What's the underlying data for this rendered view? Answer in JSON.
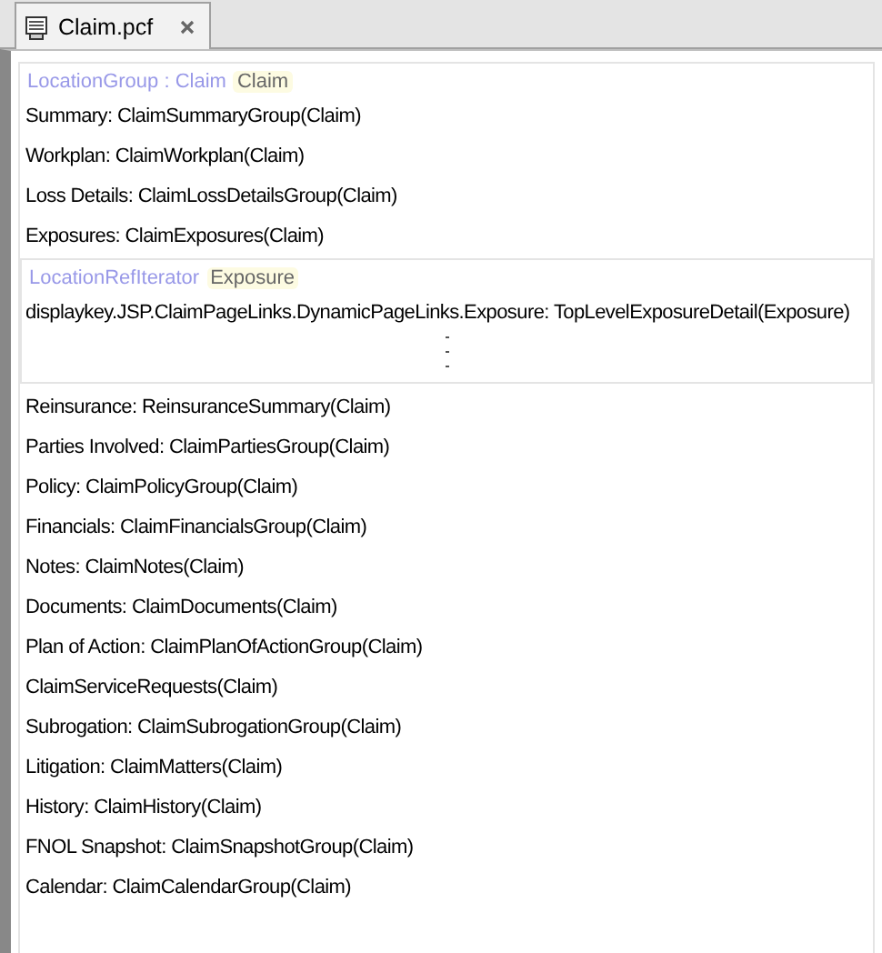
{
  "tabs": [
    {
      "label": "Claim.pcf",
      "selected": true
    }
  ],
  "group": {
    "label": "LocationGroup : Claim",
    "badge": "Claim",
    "entries": [
      {
        "kind": "link",
        "text": "Summary: ClaimSummaryGroup(Claim)"
      },
      {
        "kind": "link",
        "text": "Workplan: ClaimWorkplan(Claim)"
      },
      {
        "kind": "link",
        "text": "Loss Details: ClaimLossDetailsGroup(Claim)"
      },
      {
        "kind": "link",
        "text": "Exposures: ClaimExposures(Claim)"
      },
      {
        "kind": "iterator",
        "label": "LocationRefIterator",
        "badge": "Exposure",
        "children": [
          {
            "text": "displaykey.JSP.ClaimPageLinks.DynamicPageLinks.Exposure: TopLevelExposureDetail(Exposure)"
          }
        ]
      },
      {
        "kind": "link",
        "text": "Reinsurance: ReinsuranceSummary(Claim)"
      },
      {
        "kind": "link",
        "text": "Parties Involved: ClaimPartiesGroup(Claim)"
      },
      {
        "kind": "link",
        "text": "Policy: ClaimPolicyGroup(Claim)"
      },
      {
        "kind": "link",
        "text": "Financials: ClaimFinancialsGroup(Claim)"
      },
      {
        "kind": "link",
        "text": "Notes: ClaimNotes(Claim)"
      },
      {
        "kind": "link",
        "text": "Documents: ClaimDocuments(Claim)"
      },
      {
        "kind": "link",
        "text": "Plan of Action: ClaimPlanOfActionGroup(Claim)"
      },
      {
        "kind": "link",
        "text": "ClaimServiceRequests(Claim)"
      },
      {
        "kind": "link",
        "text": "Subrogation: ClaimSubrogationGroup(Claim)"
      },
      {
        "kind": "link",
        "text": "Litigation: ClaimMatters(Claim)"
      },
      {
        "kind": "link",
        "text": "History: ClaimHistory(Claim)"
      },
      {
        "kind": "link",
        "text": "FNOL Snapshot: ClaimSnapshotGroup(Claim)"
      },
      {
        "kind": "link",
        "text": "Calendar: ClaimCalendarGroup(Claim)"
      }
    ]
  }
}
